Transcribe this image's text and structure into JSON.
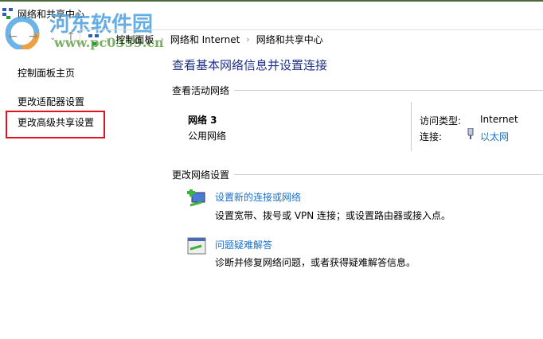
{
  "window": {
    "title": "网络和共享中心"
  },
  "watermark": {
    "name": "河东软件园",
    "url": "www.pc0359.cn"
  },
  "breadcrumb": [
    "控制面板",
    "网络和 Internet",
    "网络和共享中心"
  ],
  "sidebar": {
    "items": [
      {
        "label": "控制面板主页"
      },
      {
        "label": "更改适配器设置"
      },
      {
        "label": "更改高级共享设置"
      }
    ]
  },
  "main": {
    "title": "查看基本网络信息并设置连接",
    "active_section": "查看活动网络",
    "network": {
      "name": "网络 3",
      "type": "公用网络",
      "access_label": "访问类型:",
      "access_value": "Internet",
      "conn_label": "连接:",
      "conn_value": "以太网"
    },
    "change_section": "更改网络设置",
    "actions": [
      {
        "title": "设置新的连接或网络",
        "desc": "设置宽带、拨号或 VPN 连接；或设置路由器或接入点。"
      },
      {
        "title": "问题疑难解答",
        "desc": "诊断并修复网络问题，或者获得疑难解答信息。"
      }
    ]
  },
  "colors": {
    "link": "#1a6fc9",
    "title": "#1e3287",
    "highlight": "#e0141e"
  }
}
